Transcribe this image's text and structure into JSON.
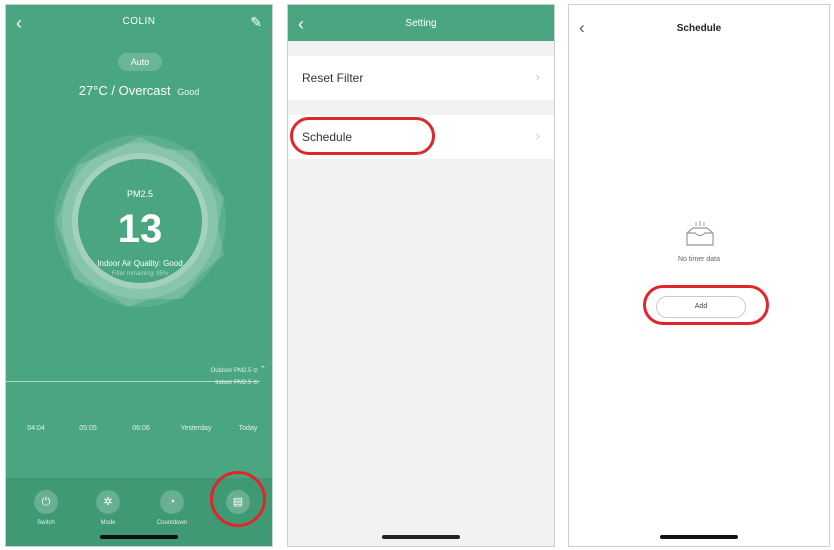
{
  "device": {
    "title": "COLIN",
    "mode": "Auto",
    "weather_main": "27°C / Overcast",
    "weather_quality": "Good",
    "pm_label": "PM2.5",
    "pm_value": "13",
    "indoor_quality": "Indoor Air Quality: Good",
    "filter_remaining": "Filter remaining: 95%",
    "legend_outdoor": "Outdoor PM2.5 ⊙",
    "legend_indoor": "Indoor PM2.5 ⊙",
    "time_labels": [
      "04:04",
      "05:05",
      "06:06",
      "Yesterday",
      "Today"
    ],
    "controls": [
      {
        "label": "Switch",
        "icon": "power-icon",
        "glyph": "⏻"
      },
      {
        "label": "Mode",
        "icon": "fan-icon",
        "glyph": "✲"
      },
      {
        "label": "Countdown",
        "icon": "timer-icon",
        "glyph": "◔"
      },
      {
        "label": "",
        "icon": "settings-icon",
        "glyph": "▤"
      }
    ]
  },
  "setting": {
    "title": "Setting",
    "items": [
      "Reset Filter",
      "Schedule"
    ]
  },
  "schedule": {
    "title": "Schedule",
    "empty_text": "No timer data",
    "add_label": "Add"
  },
  "colors": {
    "brand_green": "#4aa680",
    "highlight_red": "#e3242b"
  }
}
